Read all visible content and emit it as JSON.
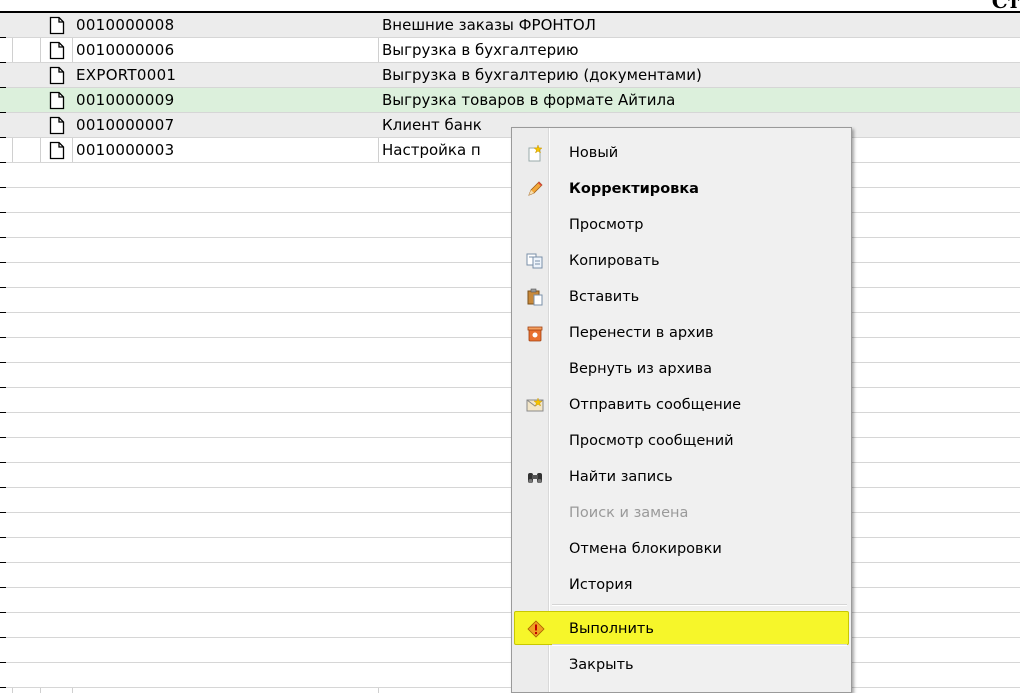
{
  "header_fragment": "Ст",
  "rows": [
    {
      "code": "0010000008",
      "name": "Внешние заказы ФРОНТОЛ",
      "style": "alt"
    },
    {
      "code": "0010000006",
      "name": "Выгрузка  в бухгалтерию",
      "style": "plain"
    },
    {
      "code": "EXPORT0001",
      "name": "Выгрузка  в бухгалтерию (документами)",
      "style": "alt"
    },
    {
      "code": "0010000009",
      "name": "Выгрузка товаров в формате Айтила",
      "style": "selected"
    },
    {
      "code": "0010000007",
      "name": "Клиент банк",
      "style": "alt"
    },
    {
      "code": "0010000003",
      "name": "Настройка п",
      "style": "plain"
    }
  ],
  "context_menu": {
    "items": [
      {
        "label": "Новый",
        "icon": "new-star-icon",
        "state": "normal"
      },
      {
        "label": "Корректировка",
        "icon": "pencil-icon",
        "state": "bold"
      },
      {
        "label": "Просмотр",
        "icon": "",
        "state": "normal"
      },
      {
        "label": "Копировать",
        "icon": "copy-icon",
        "state": "normal"
      },
      {
        "label": "Вставить",
        "icon": "paste-icon",
        "state": "normal"
      },
      {
        "label": "Перенести в архив",
        "icon": "archive-icon",
        "state": "normal"
      },
      {
        "label": "Вернуть из архива",
        "icon": "",
        "state": "normal"
      },
      {
        "label": "Отправить сообщение",
        "icon": "send-message-icon",
        "state": "normal"
      },
      {
        "label": "Просмотр сообщений",
        "icon": "",
        "state": "normal"
      },
      {
        "label": "Найти запись",
        "icon": "binoculars-icon",
        "state": "normal"
      },
      {
        "label": "Поиск и замена",
        "icon": "",
        "state": "disabled"
      },
      {
        "label": "Отмена блокировки",
        "icon": "",
        "state": "normal"
      },
      {
        "label": "История",
        "icon": "",
        "state": "normal"
      },
      {
        "label": "Выполнить",
        "icon": "execute-icon",
        "state": "highlight"
      },
      {
        "label": "Закрыть",
        "icon": "",
        "state": "normal"
      }
    ]
  },
  "colors": {
    "selected_row": "#dcf0dc",
    "alt_row": "#ececec",
    "menu_highlight": "#f6f62a"
  }
}
